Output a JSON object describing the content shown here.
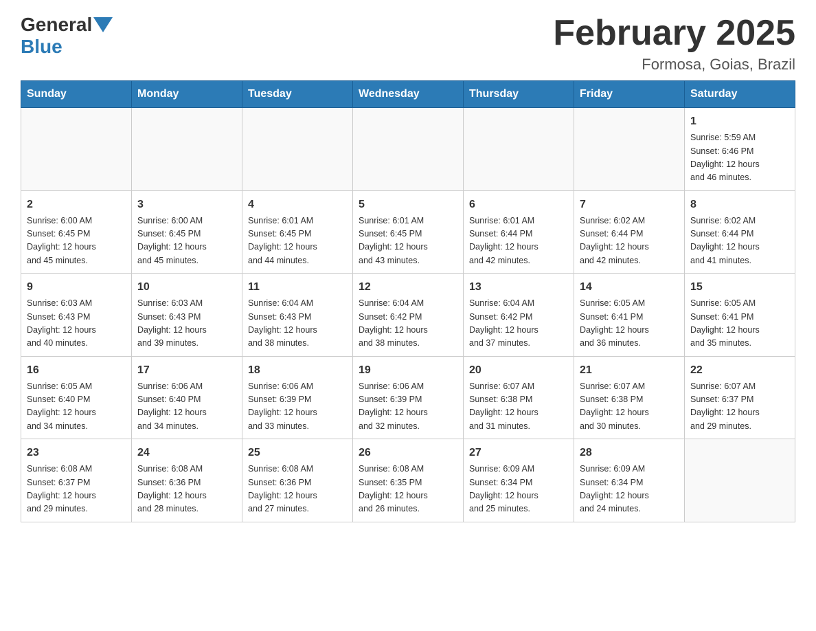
{
  "header": {
    "logo_general": "General",
    "logo_blue": "Blue",
    "month_title": "February 2025",
    "location": "Formosa, Goias, Brazil"
  },
  "weekdays": [
    "Sunday",
    "Monday",
    "Tuesday",
    "Wednesday",
    "Thursday",
    "Friday",
    "Saturday"
  ],
  "weeks": [
    [
      {
        "day": "",
        "info": ""
      },
      {
        "day": "",
        "info": ""
      },
      {
        "day": "",
        "info": ""
      },
      {
        "day": "",
        "info": ""
      },
      {
        "day": "",
        "info": ""
      },
      {
        "day": "",
        "info": ""
      },
      {
        "day": "1",
        "info": "Sunrise: 5:59 AM\nSunset: 6:46 PM\nDaylight: 12 hours\nand 46 minutes."
      }
    ],
    [
      {
        "day": "2",
        "info": "Sunrise: 6:00 AM\nSunset: 6:45 PM\nDaylight: 12 hours\nand 45 minutes."
      },
      {
        "day": "3",
        "info": "Sunrise: 6:00 AM\nSunset: 6:45 PM\nDaylight: 12 hours\nand 45 minutes."
      },
      {
        "day": "4",
        "info": "Sunrise: 6:01 AM\nSunset: 6:45 PM\nDaylight: 12 hours\nand 44 minutes."
      },
      {
        "day": "5",
        "info": "Sunrise: 6:01 AM\nSunset: 6:45 PM\nDaylight: 12 hours\nand 43 minutes."
      },
      {
        "day": "6",
        "info": "Sunrise: 6:01 AM\nSunset: 6:44 PM\nDaylight: 12 hours\nand 42 minutes."
      },
      {
        "day": "7",
        "info": "Sunrise: 6:02 AM\nSunset: 6:44 PM\nDaylight: 12 hours\nand 42 minutes."
      },
      {
        "day": "8",
        "info": "Sunrise: 6:02 AM\nSunset: 6:44 PM\nDaylight: 12 hours\nand 41 minutes."
      }
    ],
    [
      {
        "day": "9",
        "info": "Sunrise: 6:03 AM\nSunset: 6:43 PM\nDaylight: 12 hours\nand 40 minutes."
      },
      {
        "day": "10",
        "info": "Sunrise: 6:03 AM\nSunset: 6:43 PM\nDaylight: 12 hours\nand 39 minutes."
      },
      {
        "day": "11",
        "info": "Sunrise: 6:04 AM\nSunset: 6:43 PM\nDaylight: 12 hours\nand 38 minutes."
      },
      {
        "day": "12",
        "info": "Sunrise: 6:04 AM\nSunset: 6:42 PM\nDaylight: 12 hours\nand 38 minutes."
      },
      {
        "day": "13",
        "info": "Sunrise: 6:04 AM\nSunset: 6:42 PM\nDaylight: 12 hours\nand 37 minutes."
      },
      {
        "day": "14",
        "info": "Sunrise: 6:05 AM\nSunset: 6:41 PM\nDaylight: 12 hours\nand 36 minutes."
      },
      {
        "day": "15",
        "info": "Sunrise: 6:05 AM\nSunset: 6:41 PM\nDaylight: 12 hours\nand 35 minutes."
      }
    ],
    [
      {
        "day": "16",
        "info": "Sunrise: 6:05 AM\nSunset: 6:40 PM\nDaylight: 12 hours\nand 34 minutes."
      },
      {
        "day": "17",
        "info": "Sunrise: 6:06 AM\nSunset: 6:40 PM\nDaylight: 12 hours\nand 34 minutes."
      },
      {
        "day": "18",
        "info": "Sunrise: 6:06 AM\nSunset: 6:39 PM\nDaylight: 12 hours\nand 33 minutes."
      },
      {
        "day": "19",
        "info": "Sunrise: 6:06 AM\nSunset: 6:39 PM\nDaylight: 12 hours\nand 32 minutes."
      },
      {
        "day": "20",
        "info": "Sunrise: 6:07 AM\nSunset: 6:38 PM\nDaylight: 12 hours\nand 31 minutes."
      },
      {
        "day": "21",
        "info": "Sunrise: 6:07 AM\nSunset: 6:38 PM\nDaylight: 12 hours\nand 30 minutes."
      },
      {
        "day": "22",
        "info": "Sunrise: 6:07 AM\nSunset: 6:37 PM\nDaylight: 12 hours\nand 29 minutes."
      }
    ],
    [
      {
        "day": "23",
        "info": "Sunrise: 6:08 AM\nSunset: 6:37 PM\nDaylight: 12 hours\nand 29 minutes."
      },
      {
        "day": "24",
        "info": "Sunrise: 6:08 AM\nSunset: 6:36 PM\nDaylight: 12 hours\nand 28 minutes."
      },
      {
        "day": "25",
        "info": "Sunrise: 6:08 AM\nSunset: 6:36 PM\nDaylight: 12 hours\nand 27 minutes."
      },
      {
        "day": "26",
        "info": "Sunrise: 6:08 AM\nSunset: 6:35 PM\nDaylight: 12 hours\nand 26 minutes."
      },
      {
        "day": "27",
        "info": "Sunrise: 6:09 AM\nSunset: 6:34 PM\nDaylight: 12 hours\nand 25 minutes."
      },
      {
        "day": "28",
        "info": "Sunrise: 6:09 AM\nSunset: 6:34 PM\nDaylight: 12 hours\nand 24 minutes."
      },
      {
        "day": "",
        "info": ""
      }
    ]
  ]
}
